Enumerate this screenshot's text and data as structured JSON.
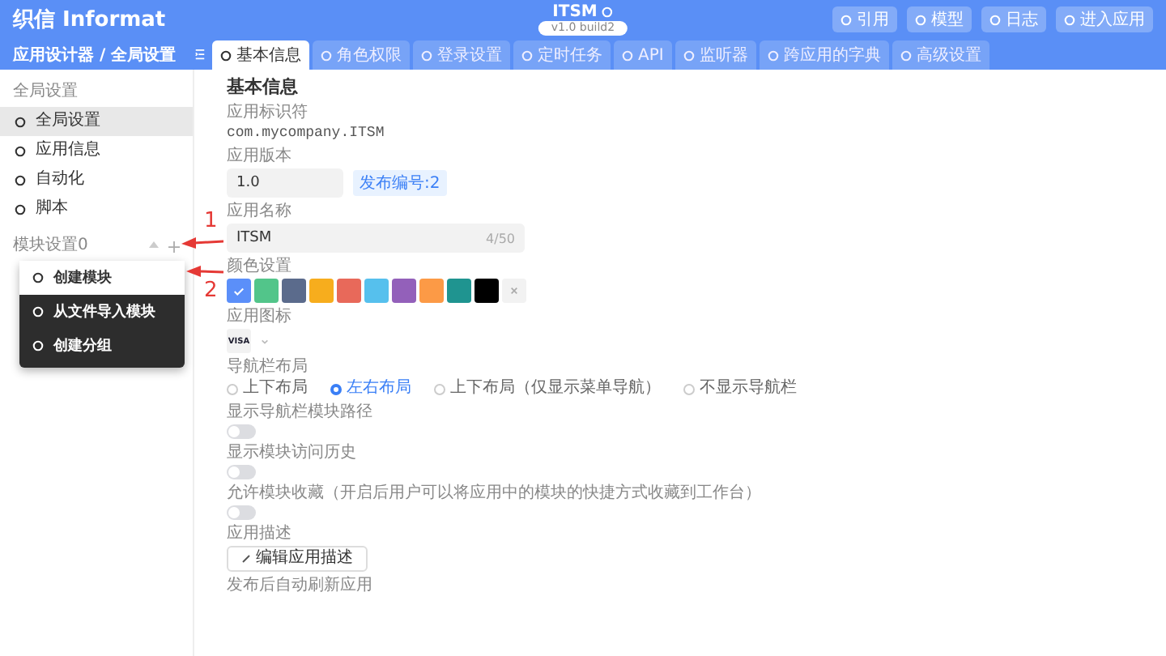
{
  "header": {
    "logo": "织信 Informat",
    "app_title": "ITSM",
    "version": "v1.0 build2",
    "actions": [
      {
        "label": "引用"
      },
      {
        "label": "模型"
      },
      {
        "label": "日志"
      },
      {
        "label": "进入应用"
      }
    ]
  },
  "breadcrumb": "应用设计器 / 全局设置",
  "tabs": [
    {
      "label": "基本信息",
      "selected": true
    },
    {
      "label": "角色权限",
      "selected": false
    },
    {
      "label": "登录设置",
      "selected": false
    },
    {
      "label": "定时任务",
      "selected": false
    },
    {
      "label": "API",
      "selected": false
    },
    {
      "label": "监听器",
      "selected": false
    },
    {
      "label": "跨应用的字典",
      "selected": false
    },
    {
      "label": "高级设置",
      "selected": false
    }
  ],
  "sidebar": {
    "section_title": "全局设置",
    "items": [
      {
        "label": "全局设置",
        "selected": true
      },
      {
        "label": "应用信息",
        "selected": false
      },
      {
        "label": "自动化",
        "selected": false
      },
      {
        "label": "脚本",
        "selected": false
      }
    ],
    "module_section_title": "模块设置0"
  },
  "context_menu": {
    "items": [
      {
        "label": "创建模块",
        "selected": true
      },
      {
        "label": "从文件导入模块",
        "selected": false
      },
      {
        "label": "创建分组",
        "selected": false
      }
    ]
  },
  "annotations": [
    {
      "label": "1"
    },
    {
      "label": "2"
    }
  ],
  "form": {
    "title": "基本信息",
    "fields": [
      {
        "kind": "text",
        "label": "应用标识符",
        "value": "com.mycompany.ITSM"
      },
      {
        "kind": "version",
        "label": "应用版本",
        "value": "1.0",
        "badge": "发布编号:2"
      },
      {
        "kind": "input",
        "label": "应用名称",
        "value": "ITSM",
        "counter": "4/50"
      },
      {
        "kind": "colors",
        "label": "颜色设置",
        "colors": [
          {
            "color": "#5b8ff9",
            "selected": true
          },
          {
            "color": "#52c58a",
            "selected": false
          },
          {
            "color": "#5b6b8c",
            "selected": false
          },
          {
            "color": "#f7ad1d",
            "selected": false
          },
          {
            "color": "#e8695a",
            "selected": false
          },
          {
            "color": "#56c0ed",
            "selected": false
          },
          {
            "color": "#9360ba",
            "selected": false
          },
          {
            "color": "#fc9a46",
            "selected": false
          },
          {
            "color": "#1f9490",
            "selected": false
          },
          {
            "color": "#000000",
            "selected": false
          }
        ]
      },
      {
        "kind": "icon",
        "label": "应用图标",
        "icon_text": "VISA"
      },
      {
        "kind": "radio",
        "label": "导航栏布局",
        "options": [
          {
            "label": "上下布局",
            "selected": false
          },
          {
            "label": "左右布局",
            "selected": true
          },
          {
            "label": "上下布局（仅显示菜单导航）",
            "selected": false
          },
          {
            "label": "不显示导航栏",
            "selected": false
          }
        ]
      },
      {
        "kind": "toggle",
        "label": "显示导航栏模块路径",
        "on": false
      },
      {
        "kind": "toggle",
        "label": "显示模块访问历史",
        "on": false
      },
      {
        "kind": "toggle",
        "label": "允许模块收藏（开启后用户可以将应用中的模块的快捷方式收藏到工作台）",
        "on": false
      },
      {
        "kind": "button",
        "label": "应用描述",
        "button": "编辑应用描述"
      },
      {
        "kind": "label",
        "label": "发布后自动刷新应用"
      }
    ]
  }
}
